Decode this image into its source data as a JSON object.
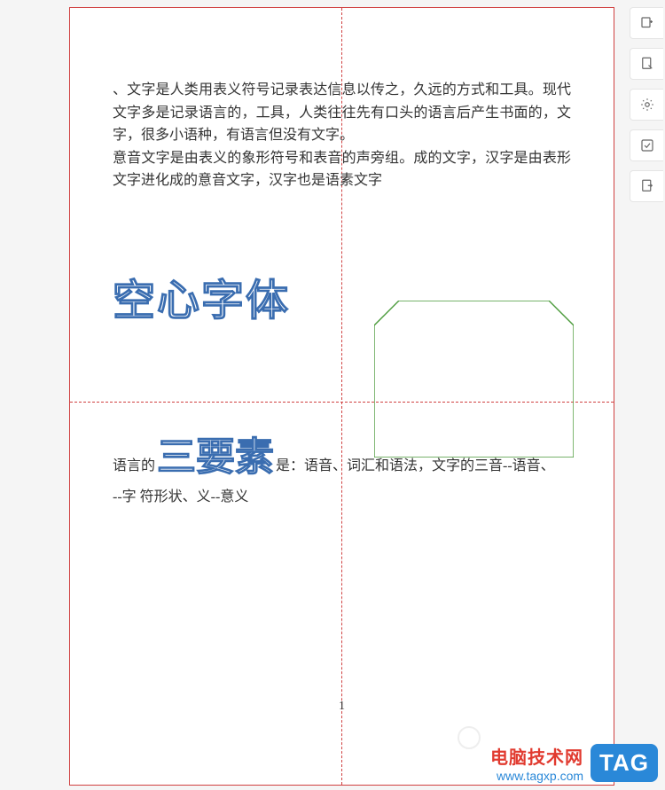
{
  "document": {
    "paragraph1": "、文字是人类用表义符号记录表达信息以传之，久远的方式和工具。现代文字多是记录语言的，工具，人类往往先有口头的语言后产生书面的，文字，很多小语种，有语言但没有文字。",
    "paragraph2": "意音文字是由表义的象形符号和表音的声旁组。成的文字，汉字是由表形文字进化成的意音文字，汉字也是语素文字",
    "outlined1": "空心字体",
    "line2_prefix": "语言的",
    "outlined2": "三要素",
    "line2_suffix": "是：语音、词汇和语法，文字的三音--语音、",
    "line3": "--字 符形状、义--意义",
    "page_number": "1"
  },
  "toolbar": {
    "items": [
      {
        "name": "tool-add-icon"
      },
      {
        "name": "tool-edit-icon"
      },
      {
        "name": "tool-settings-icon"
      },
      {
        "name": "tool-check-icon"
      },
      {
        "name": "tool-export-icon"
      }
    ]
  },
  "watermark": {
    "line1": "电脑技术网",
    "line2": "www.tagxp.com",
    "badge": "TAG"
  }
}
